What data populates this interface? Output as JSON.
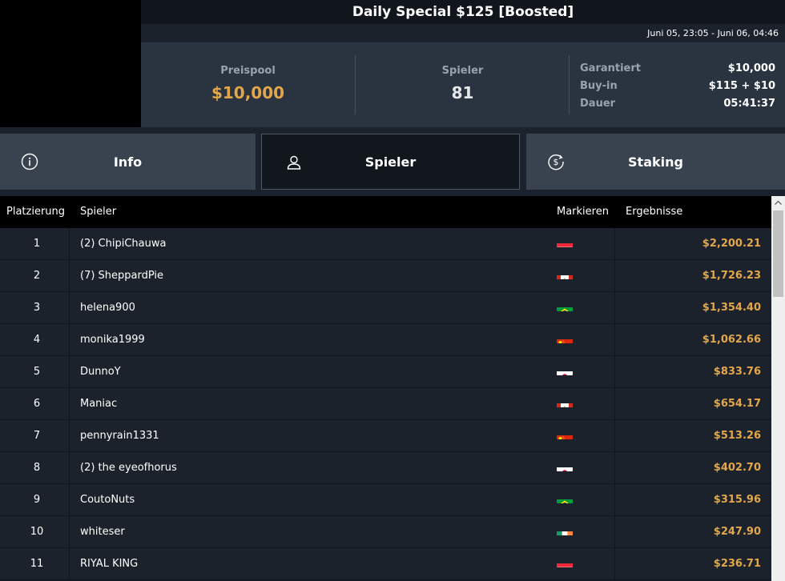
{
  "header": {
    "title": "Daily Special $125 [Boosted]",
    "date_range": "Juni 05, 23:05 - Juni 06, 04:46"
  },
  "stats": {
    "prize_pool_label": "Preispool",
    "prize_pool_value": "$10,000",
    "players_label": "Spieler",
    "players_value": "81",
    "details": [
      {
        "label": "Garantiert",
        "value": "$10,000"
      },
      {
        "label": "Buy-in",
        "value": "$115 + $10"
      },
      {
        "label": "Dauer",
        "value": "05:41:37"
      }
    ]
  },
  "tabs": [
    {
      "label": "Info",
      "icon": "info-icon"
    },
    {
      "label": "Spieler",
      "icon": "user-icon",
      "active": true
    },
    {
      "label": "Staking",
      "icon": "dollar-coin-icon"
    }
  ],
  "table": {
    "columns": [
      "Platzierung",
      "Spieler",
      "Markieren",
      "Ergebnisse"
    ],
    "rows": [
      {
        "rank": "1",
        "player": "(2) ChipiChauwa",
        "flag": "austria",
        "result": "$2,200.21"
      },
      {
        "rank": "2",
        "player": "(7) SheppardPie",
        "flag": "canada",
        "result": "$1,726.23"
      },
      {
        "rank": "3",
        "player": "helena900",
        "flag": "brazil",
        "result": "$1,354.40"
      },
      {
        "rank": "4",
        "player": "monika1999",
        "flag": "china",
        "result": "$1,062.66"
      },
      {
        "rank": "5",
        "player": "DunnoY",
        "flag": "japan",
        "result": "$833.76"
      },
      {
        "rank": "6",
        "player": "Maniac",
        "flag": "canada",
        "result": "$654.17"
      },
      {
        "rank": "7",
        "player": "pennyrain1331",
        "flag": "china",
        "result": "$513.26"
      },
      {
        "rank": "8",
        "player": "(2) the eyeofhorus",
        "flag": "japan",
        "result": "$402.70"
      },
      {
        "rank": "9",
        "player": "CoutoNuts",
        "flag": "brazil",
        "result": "$315.96"
      },
      {
        "rank": "10",
        "player": "whiteser",
        "flag": "ireland",
        "result": "$247.90"
      },
      {
        "rank": "11",
        "player": "RIYAL KING",
        "flag": "austria",
        "result": "$236.71"
      }
    ]
  },
  "colors": {
    "accent_gold": "#e3a64a",
    "background": "#1b222b",
    "panel": "#2a3440"
  }
}
